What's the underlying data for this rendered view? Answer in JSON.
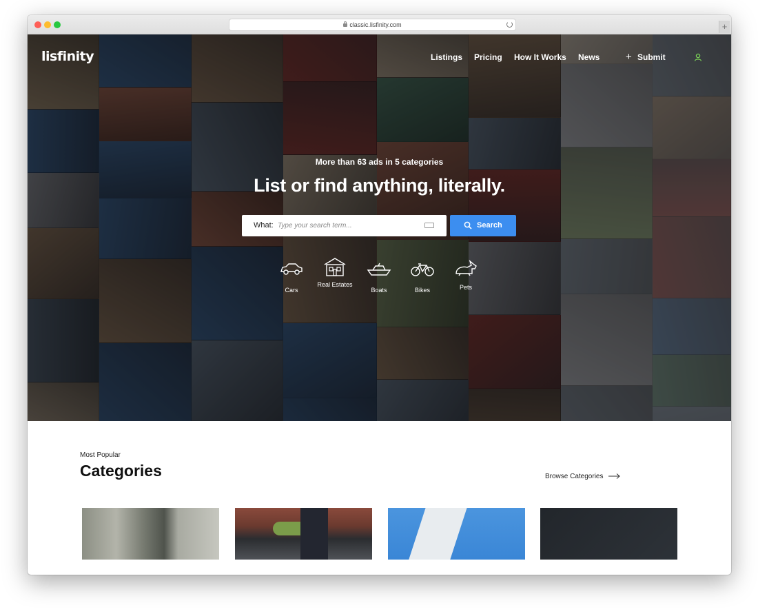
{
  "browser": {
    "url": "classic.lisfinity.com"
  },
  "header": {
    "logo": "lisfinity",
    "nav": [
      "Listings",
      "Pricing",
      "How It Works",
      "News"
    ],
    "submit_label": "Submit"
  },
  "hero": {
    "subtitle": "More than 63 ads in 5 categories",
    "title": "List or find anything, literally.",
    "search": {
      "label": "What:",
      "placeholder": "Type your search term...",
      "button_label": "Search"
    },
    "categories": [
      {
        "label": "Cars",
        "icon": "car-icon"
      },
      {
        "label": "Real Estates",
        "icon": "house-icon"
      },
      {
        "label": "Boats",
        "icon": "boat-icon"
      },
      {
        "label": "Bikes",
        "icon": "bike-icon"
      },
      {
        "label": "Pets",
        "icon": "rabbit-icon"
      }
    ]
  },
  "popular": {
    "eyebrow": "Most Popular",
    "title": "Categories",
    "browse_label": "Browse Categories"
  },
  "colors": {
    "accent": "#3c8ef0",
    "hero_overlay": "#15171a"
  }
}
